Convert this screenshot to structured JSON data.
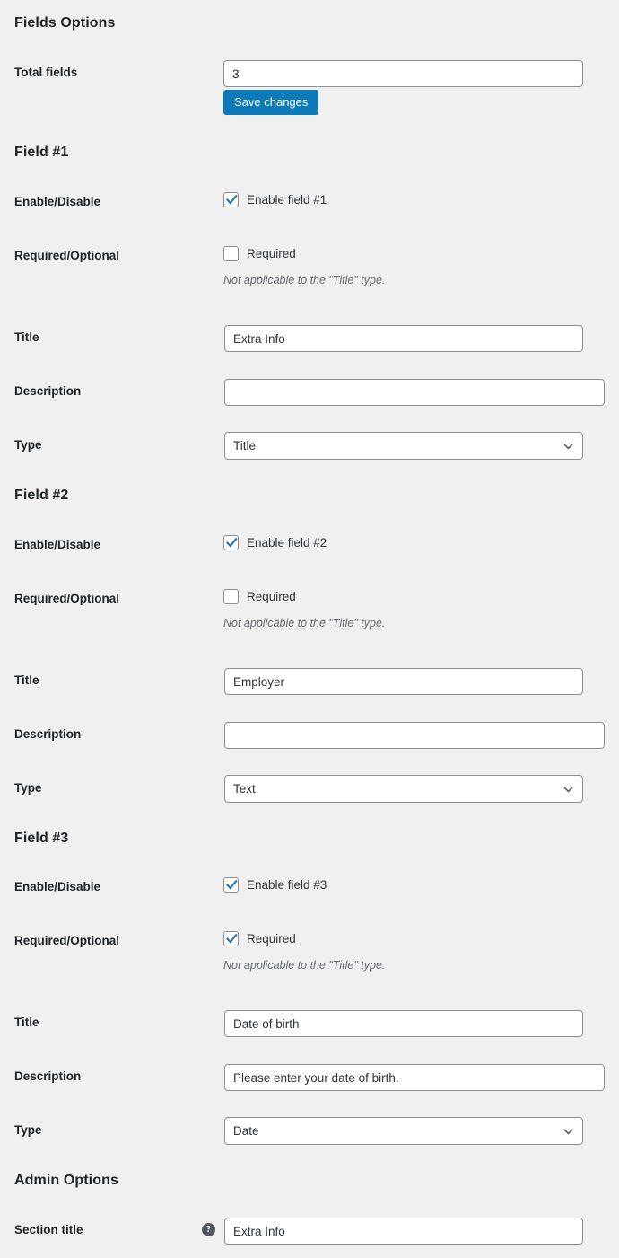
{
  "sections": {
    "fields_options_heading": "Fields Options",
    "admin_options_heading": "Admin Options"
  },
  "total_fields": {
    "label": "Total fields",
    "value": "3"
  },
  "save_button": {
    "label": "Save changes"
  },
  "row_labels": {
    "enable_disable": "Enable/Disable",
    "required_optional": "Required/Optional",
    "title": "Title",
    "description": "Description",
    "type": "Type",
    "section_title": "Section title"
  },
  "hint_text": "Not applicable to the \"Title\" type.",
  "fields": [
    {
      "heading": "Field #1",
      "enable_label": "Enable field #1",
      "enable_checked": true,
      "required_label": "Required",
      "required_checked": false,
      "title_value": "Extra Info",
      "description_value": "",
      "type_value": "Title"
    },
    {
      "heading": "Field #2",
      "enable_label": "Enable field #2",
      "enable_checked": true,
      "required_label": "Required",
      "required_checked": false,
      "title_value": "Employer",
      "description_value": "",
      "type_value": "Text"
    },
    {
      "heading": "Field #3",
      "enable_label": "Enable field #3",
      "enable_checked": true,
      "required_label": "Required",
      "required_checked": true,
      "title_value": "Date of birth",
      "description_value": "Please enter your date of birth.",
      "type_value": "Date"
    }
  ],
  "admin": {
    "section_title_value": "Extra Info",
    "help_glyph": "?"
  },
  "colors": {
    "page_background": "#f0f0f1",
    "heading_text": "#1d2327",
    "body_text": "#3c434a",
    "input_border": "#8c8f94",
    "accent_button": "#0c7ab8",
    "checkbox_check": "#2271b1",
    "hint_text": "#646970"
  }
}
